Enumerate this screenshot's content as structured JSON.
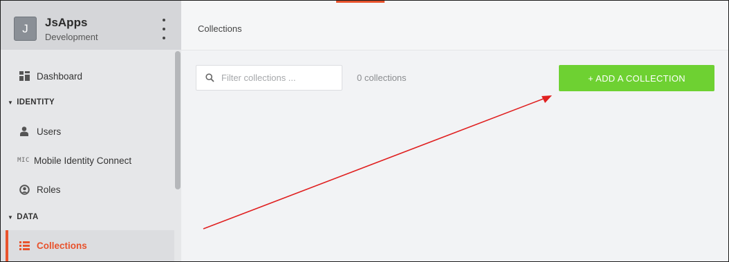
{
  "app": {
    "initial": "J",
    "name": "JsApps",
    "environment": "Development"
  },
  "sidebar": {
    "dashboard": "Dashboard",
    "identity_section": "IDENTITY",
    "users": "Users",
    "mic_icon": "MIC",
    "mobile_identity_connect": "Mobile Identity Connect",
    "roles": "Roles",
    "data_section": "DATA",
    "collections": "Collections"
  },
  "header": {
    "breadcrumb": "Collections"
  },
  "filter": {
    "placeholder": "Filter collections ...",
    "value": ""
  },
  "collections_count": "0 collections",
  "add_button_label": "+ ADD A COLLECTION",
  "colors": {
    "accent": "#e8522c",
    "add_button": "#6ed132",
    "annotation_arrow": "#e02020"
  },
  "icons": [
    "dashboard-icon",
    "user-icon",
    "mic-icon",
    "roles-icon",
    "collections-icon",
    "search-icon",
    "kebab-menu-icon"
  ]
}
